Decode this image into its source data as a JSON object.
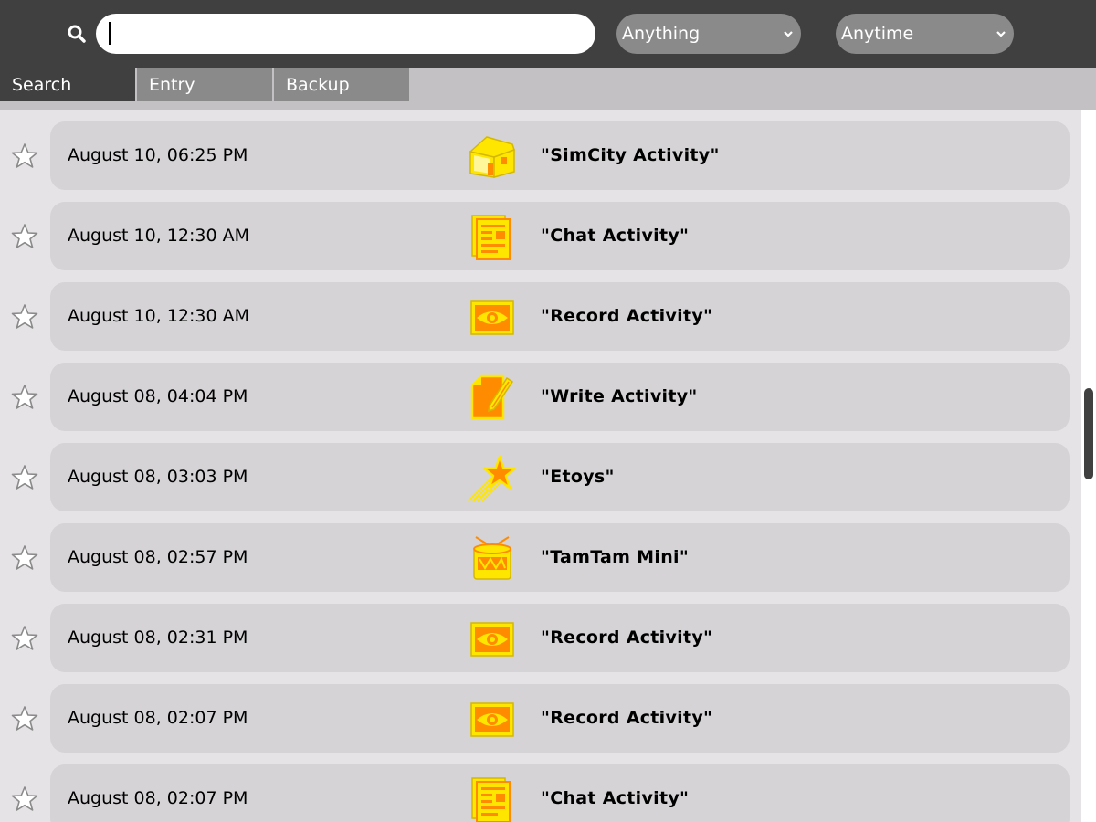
{
  "toolbar": {
    "search_value": "",
    "what_filter": "Anything",
    "when_filter": "Anytime"
  },
  "tabs": [
    {
      "label": "Search"
    },
    {
      "label": "Entry"
    },
    {
      "label": "Backup"
    }
  ],
  "entries": [
    {
      "date": "August 10, 06:25 PM",
      "title": "\"SimCity Activity\"",
      "icon": "simcity-house-icon"
    },
    {
      "date": "August 10, 12:30 AM",
      "title": "\"Chat Activity\"",
      "icon": "chat-document-icon"
    },
    {
      "date": "August 10, 12:30 AM",
      "title": "\"Record Activity\"",
      "icon": "record-eye-icon"
    },
    {
      "date": "August 08, 04:04 PM",
      "title": "\"Write Activity\"",
      "icon": "write-pencil-icon"
    },
    {
      "date": "August 08, 03:03 PM",
      "title": "\"Etoys\"",
      "icon": "etoys-star-icon"
    },
    {
      "date": "August 08, 02:57 PM",
      "title": "\"TamTam Mini\"",
      "icon": "tamtam-drum-icon"
    },
    {
      "date": "August 08, 02:31 PM",
      "title": "\"Record Activity\"",
      "icon": "record-eye-icon"
    },
    {
      "date": "August 08, 02:07 PM",
      "title": "\"Record Activity\"",
      "icon": "record-eye-icon"
    },
    {
      "date": "August 08, 02:07 PM",
      "title": "\"Chat Activity\"",
      "icon": "chat-document-icon"
    }
  ],
  "colors": {
    "toolbar_bg": "#404040",
    "tab_inactive": "#8a8a8a",
    "card_bg": "#d5d3d6",
    "icon_yellow": "#ffe600",
    "icon_orange": "#ff8c00"
  }
}
